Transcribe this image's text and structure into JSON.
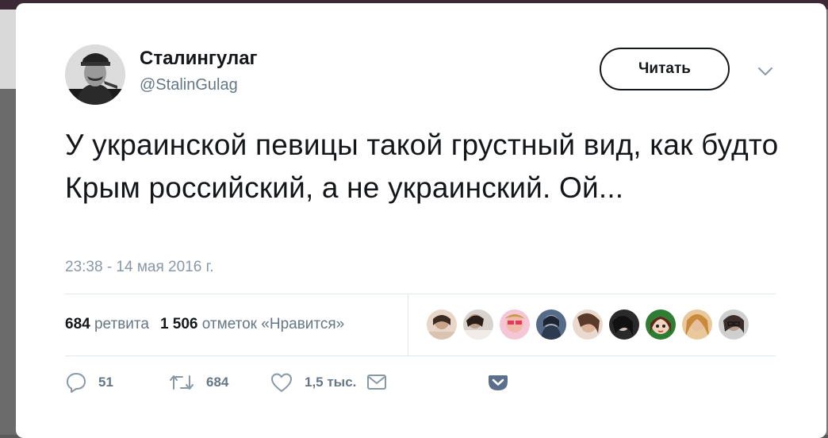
{
  "tweet": {
    "author_name": "Сталингулаг",
    "author_handle": "@StalinGulag",
    "follow_label": "Читать",
    "text": "У украинской певицы такой грустный вид, как будто Крым российский, а не украинский. Ой...",
    "timestamp": "23:38 - 14 мая 2016 г."
  },
  "stats": {
    "retweets_count": "684",
    "retweets_label": "ретвита",
    "likes_count": "1 506",
    "likes_label": "отметок «Нравится»"
  },
  "actions": {
    "replies": "51",
    "retweets": "684",
    "likes": "1,5 тыс."
  },
  "icons": [
    "reply-icon",
    "retweet-icon",
    "heart-icon",
    "message-icon",
    "pocket-icon",
    "chevron-down-icon"
  ],
  "colors": {
    "text": "#14171a",
    "secondary": "#657786",
    "timestamp": "#8899a6",
    "divider": "#e1e8ed",
    "pocket": "#5b6f8c"
  }
}
